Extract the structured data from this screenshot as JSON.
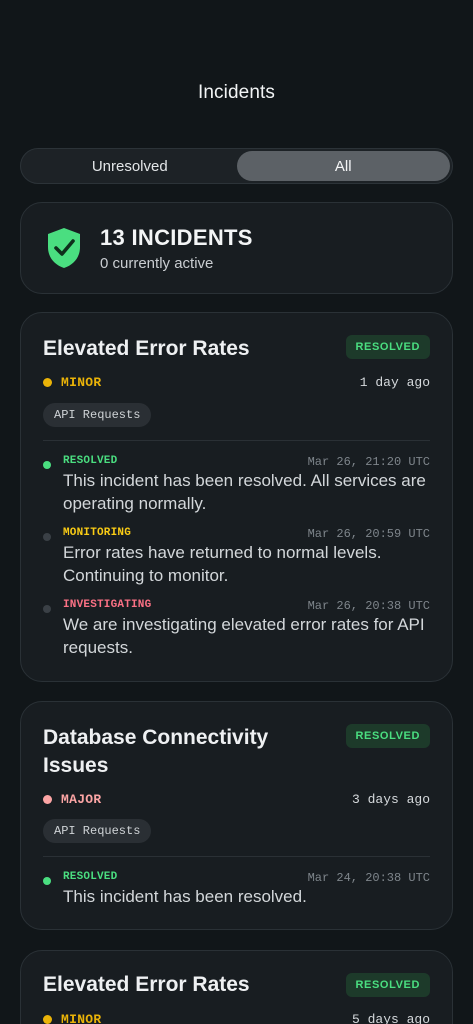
{
  "header": {
    "title": "Incidents"
  },
  "filter": {
    "options": [
      "Unresolved",
      "All"
    ],
    "selected": "All"
  },
  "summary": {
    "count_label": "13 INCIDENTS",
    "active_label": "0 currently active",
    "icon": "shield-check-icon"
  },
  "colors": {
    "resolved": "#4ade80",
    "monitoring": "#facc15",
    "investigating": "#fb7185",
    "minor": "#eab308",
    "major": "#f87171"
  },
  "incidents": [
    {
      "name": "Elevated Error Rates",
      "status_badge": "RESOLVED",
      "impact": "MINOR",
      "ago": "1 day ago",
      "component": "API Requests",
      "updates": [
        {
          "status": "RESOLVED",
          "time": "Mar 26, 21:20 UTC",
          "message": "This incident has been resolved. All services are operating normally."
        },
        {
          "status": "MONITORING",
          "time": "Mar 26, 20:59 UTC",
          "message": "Error rates have returned to normal levels. Continuing to monitor."
        },
        {
          "status": "INVESTIGATING",
          "time": "Mar 26, 20:38 UTC",
          "message": "We are investigating elevated error rates for API requests."
        }
      ]
    },
    {
      "name": "Database Connectivity Issues",
      "status_badge": "RESOLVED",
      "impact": "MAJOR",
      "ago": "3 days ago",
      "component": "API Requests",
      "updates": [
        {
          "status": "RESOLVED",
          "time": "Mar 24, 20:38 UTC",
          "message": "This incident has been resolved."
        }
      ]
    },
    {
      "name": "Elevated Error Rates",
      "status_badge": "RESOLVED",
      "impact": "MINOR",
      "ago": "5 days ago"
    }
  ]
}
